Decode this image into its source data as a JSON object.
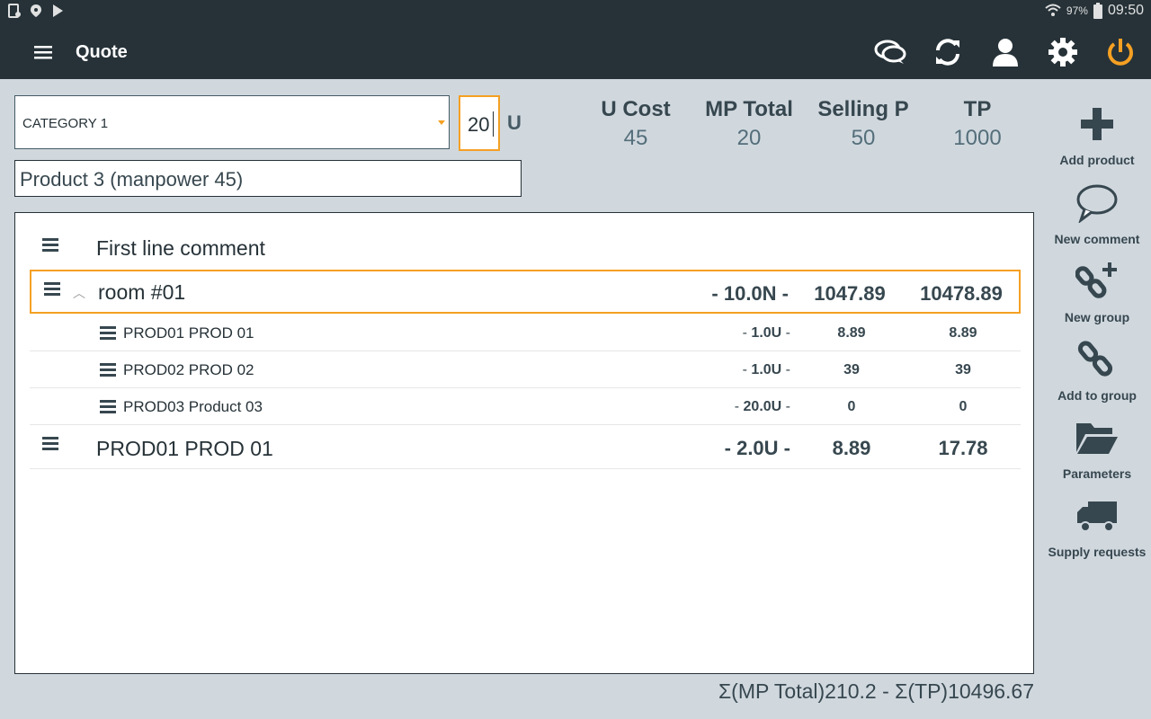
{
  "status_bar": {
    "battery": "97%",
    "time": "09:50"
  },
  "app_bar": {
    "title": "Quote",
    "actions": [
      "chat-icon",
      "sync-icon",
      "account-icon",
      "settings-icon",
      "power-icon"
    ],
    "accent_color": "#f5a023"
  },
  "form": {
    "category": "CATEGORY 1",
    "quantity": "20",
    "unit": "U",
    "product": "Product 3 (manpower 45)"
  },
  "stats": [
    {
      "label": "U Cost",
      "value": "45"
    },
    {
      "label": "MP Total",
      "value": "20"
    },
    {
      "label": "Selling P",
      "value": "50"
    },
    {
      "label": "TP",
      "value": "1000"
    }
  ],
  "rows": {
    "comment": {
      "label": "First line comment"
    },
    "group": {
      "label": "room #01",
      "qty": "- 10.0N -",
      "mp": "1047.89",
      "tp": "10478.89"
    },
    "children": [
      {
        "label": "PROD01 PROD 01",
        "qty_prefix": "- ",
        "qty": "1.0U",
        "qty_suffix": " -",
        "mp": "8.89",
        "tp": "8.89"
      },
      {
        "label": "PROD02 PROD 02",
        "qty_prefix": "- ",
        "qty": "1.0U",
        "qty_suffix": " -",
        "mp": "39",
        "tp": "39"
      },
      {
        "label": "PROD03 Product 03",
        "qty_prefix": "- ",
        "qty": "20.0U",
        "qty_suffix": " -",
        "mp": "0",
        "tp": "0"
      }
    ],
    "item": {
      "label": "PROD01 PROD 01",
      "qty": "- 2.0U -",
      "mp": "8.89",
      "tp": "17.78"
    }
  },
  "side_actions": [
    {
      "label": "Add product",
      "icon": "plus-icon"
    },
    {
      "label": "New comment",
      "icon": "comment-icon"
    },
    {
      "label": "New group",
      "icon": "link-plus-icon"
    },
    {
      "label": "Add to group",
      "icon": "link-icon"
    },
    {
      "label": "Parameters",
      "icon": "folder-open-icon"
    },
    {
      "label": "Supply requests",
      "icon": "truck-icon"
    }
  ],
  "totals": "Σ(MP Total)210.2 - Σ(TP)10496.67"
}
